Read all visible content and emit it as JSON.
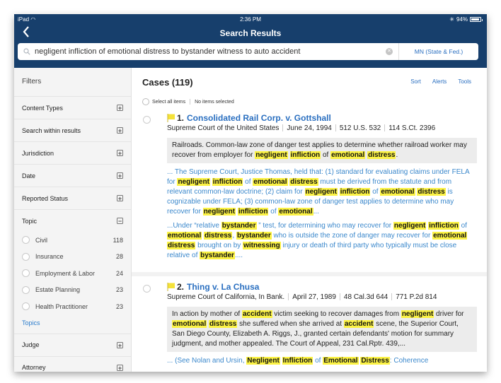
{
  "status_bar": {
    "device": "iPad",
    "time": "2:36 PM",
    "battery": "94%",
    "battery_level": 0.94
  },
  "nav": {
    "title": "Search Results",
    "back_label": "Back"
  },
  "search": {
    "query": "negligent infliction of emotional distress to bystander witness to auto accident",
    "jurisdiction": "MN (State & Fed.)"
  },
  "sidebar": {
    "title": "Filters",
    "filters_before": [
      {
        "label": "Content Types",
        "state": "+"
      },
      {
        "label": "Search within results",
        "state": "+"
      },
      {
        "label": "Jurisdiction",
        "state": "+"
      },
      {
        "label": "Date",
        "state": "+"
      },
      {
        "label": "Reported Status",
        "state": "+"
      }
    ],
    "topic": {
      "label": "Topic",
      "state": "−",
      "items": [
        {
          "label": "Civil",
          "count": "118"
        },
        {
          "label": "Insurance",
          "count": "28"
        },
        {
          "label": "Employment & Labor",
          "count": "24"
        },
        {
          "label": "Estate Planning",
          "count": "23"
        },
        {
          "label": "Health Practitioner",
          "count": "23"
        }
      ],
      "more_link": "Topics"
    },
    "filters_after": [
      {
        "label": "Judge",
        "state": "+"
      },
      {
        "label": "Attorney",
        "state": "+"
      }
    ]
  },
  "main": {
    "title": "Cases (119)",
    "actions": [
      "Sort",
      "Alerts",
      "Tools"
    ],
    "select_all": "Select all items",
    "selection_status": "No items selected",
    "results": [
      {
        "number": "1.",
        "name": "Consolidated Rail Corp. v. Gottshall",
        "meta": [
          "Supreme Court of the United States",
          "June 24, 1994",
          "512 U.S. 532",
          "114 S.Ct. 2396"
        ],
        "summary": "Railroads. Common-law zone of danger test applies to determine whether railroad worker may recover from employer for [[negligent]] [[infliction]] of [[emotional]] [[distress]].",
        "excerpts": [
          "...  The Supreme Court, Justice Thomas, held that:  (1) standard for evaluating claims under FELA for [[negligent]] [[infliction]] of [[emotional]] [[distress]] must be derived from the statute and from relevant common-law doctrine;  (2) claim for [[negligent]] [[infliction]] of [[emotional]] [[distress]] is cognizable under FELA;  (3) common-law zone of danger test applies to determine who may recover for [[negligent]] [[infliction]] of [[emotional]]...",
          "...Under “relative [[bystander]] ” test, for determining who may recover for [[negligent]] [[infliction]] of [[emotional]] [[distress]], [[bystander]] who is outside the zone of danger may recover for [[emotional]] [[distress]] brought on by [[witnessing]] injury or death of third party who typically must be close relative of [[bystander]]...."
        ]
      },
      {
        "number": "2.",
        "name": "Thing v. La Chusa",
        "meta": [
          "Supreme Court of California, In Bank.",
          "April 27, 1989",
          "48 Cal.3d 644",
          "771 P.2d 814"
        ],
        "summary": "In action by mother of [[accident]] victim seeking to recover damages from [[negligent]] driver for [[emotional]] [[distress]] she suffered when she arrived at [[accident]] scene, the Superior Court, San Diego County, Elizabeth A. Riggs, J., granted certain defendants' motion for summary judgment, and mother appealed.    The Court of Appeal, 231 Cal.Rptr. 439,...",
        "excerpts": [
          "...  (See Nolan and Ursin, [[Negligent]] [[Infliction]] of [[Emotional]] [[Distress]]:  Coherence"
        ]
      }
    ]
  },
  "colors": {
    "header_bg": "#173f6c",
    "link": "#2a6fc0",
    "highlight": "#fbf244",
    "flag": "#f5e23a"
  }
}
